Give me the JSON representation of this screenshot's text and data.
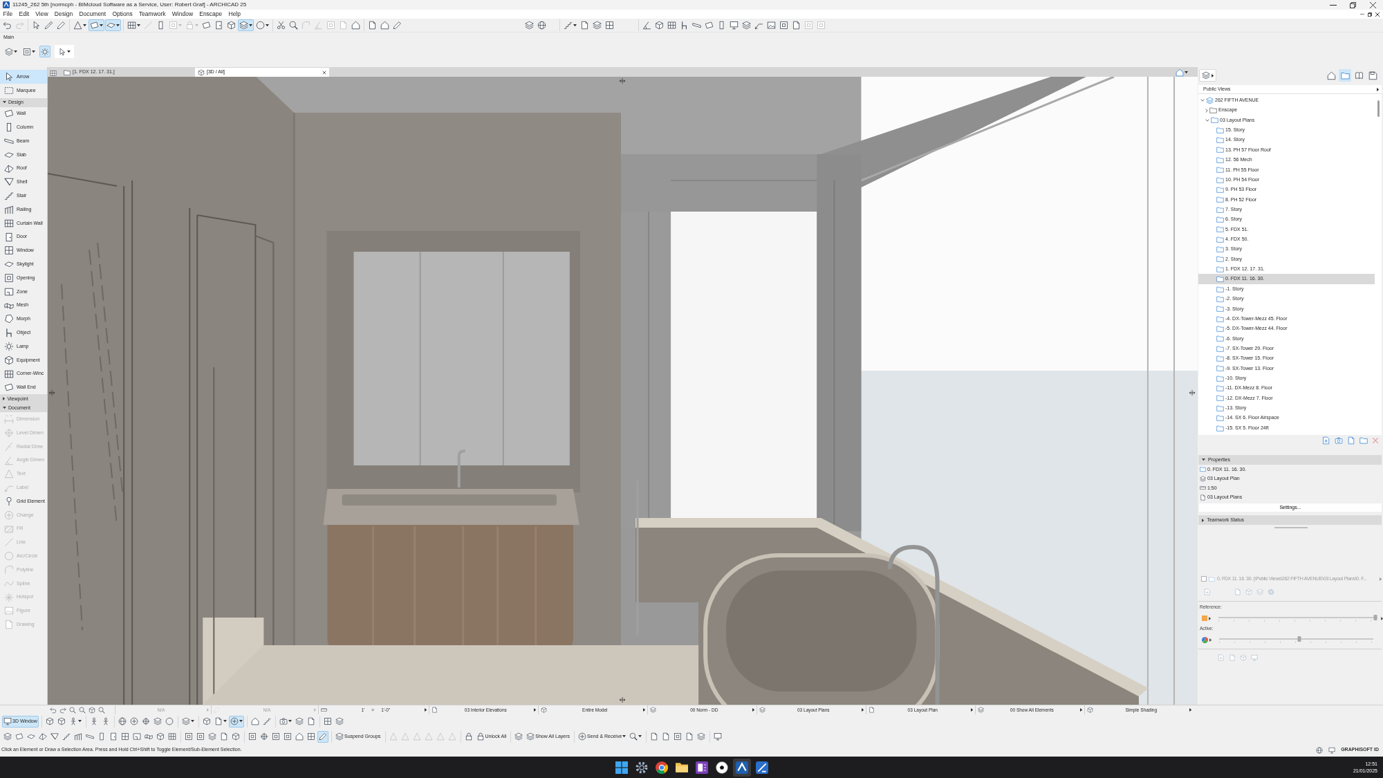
{
  "window": {
    "title": "11245_262 5th [normcph - BIMcloud Software as a Service, User: Robert Graf] - ARCHICAD 25"
  },
  "menu": [
    "File",
    "Edit",
    "View",
    "Design",
    "Document",
    "Options",
    "Teamwork",
    "Window",
    "Enscape",
    "Help"
  ],
  "toolbar": [
    [
      {
        "selected": false,
        "disabled": false,
        "dropdown": false
      },
      {
        "selected": false,
        "disabled": true,
        "dropdown": false
      }
    ],
    [
      {
        "selected": false,
        "disabled": false,
        "dropdown": false
      },
      {
        "selected": false,
        "disabled": false,
        "dropdown": false
      },
      {
        "selected": false,
        "disabled": false,
        "dropdown": false
      }
    ],
    [
      {
        "selected": false,
        "disabled": false,
        "dropdown": true
      },
      {
        "selected": true,
        "disabled": false,
        "dropdown": true
      },
      {
        "selected": true,
        "disabled": false,
        "dropdown": true
      }
    ],
    [
      {
        "selected": false,
        "disabled": false,
        "dropdown": true
      },
      {
        "selected": false,
        "disabled": true,
        "dropdown": false
      },
      {
        "selected": false,
        "disabled": false,
        "dropdown": false
      },
      {
        "selected": false,
        "disabled": true,
        "dropdown": true
      },
      {
        "selected": false,
        "disabled": true,
        "dropdown": true
      },
      {
        "selected": false,
        "disabled": false,
        "dropdown": false
      },
      {
        "selected": false,
        "disabled": false,
        "dropdown": false
      },
      {
        "selected": false,
        "disabled": false,
        "dropdown": false
      },
      {
        "selected": true,
        "disabled": false,
        "dropdown": true
      },
      {
        "selected": false,
        "disabled": false,
        "dropdown": true
      }
    ],
    [
      {
        "selected": false,
        "disabled": false,
        "dropdown": false
      },
      {
        "selected": false,
        "disabled": false,
        "dropdown": false
      },
      {
        "selected": false,
        "disabled": true,
        "dropdown": false
      },
      {
        "selected": false,
        "disabled": true,
        "dropdown": false
      },
      {
        "selected": false,
        "disabled": true,
        "dropdown": false
      },
      {
        "selected": false,
        "disabled": true,
        "dropdown": false
      },
      {
        "selected": false,
        "disabled": false,
        "dropdown": false
      }
    ],
    [
      {
        "selected": false,
        "disabled": false,
        "dropdown": false
      },
      {
        "selected": false,
        "disabled": false,
        "dropdown": false
      },
      {
        "selected": false,
        "disabled": false,
        "dropdown": false
      }
    ],
    [
      {
        "selected": false,
        "disabled": false,
        "dropdown": false
      },
      {
        "selected": false,
        "disabled": false,
        "dropdown": false
      }
    ],
    [
      {
        "selected": false,
        "disabled": false,
        "dropdown": true
      },
      {
        "selected": false,
        "disabled": false,
        "dropdown": false
      },
      {
        "selected": false,
        "disabled": false,
        "dropdown": false
      },
      {
        "selected": false,
        "disabled": false,
        "dropdown": false
      }
    ],
    [
      {
        "selected": false,
        "disabled": false,
        "dropdown": false
      },
      {
        "selected": false,
        "disabled": false,
        "dropdown": false
      },
      {
        "selected": false,
        "disabled": false,
        "dropdown": false
      },
      {
        "selected": false,
        "disabled": false,
        "dropdown": false
      },
      {
        "selected": false,
        "disabled": false,
        "dropdown": false
      },
      {
        "selected": false,
        "disabled": false,
        "dropdown": false
      },
      {
        "selected": false,
        "disabled": false,
        "dropdown": false
      },
      {
        "selected": false,
        "disabled": false,
        "dropdown": false
      },
      {
        "selected": false,
        "disabled": false,
        "dropdown": false
      },
      {
        "selected": false,
        "disabled": false,
        "dropdown": false
      },
      {
        "selected": false,
        "disabled": false,
        "dropdown": false
      },
      {
        "selected": false,
        "disabled": false,
        "dropdown": false
      },
      {
        "selected": false,
        "disabled": false,
        "dropdown": false
      },
      {
        "selected": false,
        "disabled": true,
        "dropdown": false
      },
      {
        "selected": false,
        "disabled": true,
        "dropdown": false
      }
    ]
  ],
  "main_toolbar": {
    "label": "Main",
    "groups": [
      [
        {
          "selected": false,
          "disabled": false,
          "dropdown": true
        },
        {
          "selected": false,
          "disabled": false,
          "dropdown": true
        },
        {
          "selected": true,
          "disabled": false,
          "dropdown": false
        }
      ],
      [
        {
          "selected": false,
          "disabled": false,
          "dropdown": true
        }
      ]
    ]
  },
  "tabs": [
    {
      "label": "[1. FDX 12. 17. 31.]",
      "selected": false
    },
    {
      "label": "[3D / All]",
      "selected": true
    }
  ],
  "toolbox": {
    "tools": [
      {
        "label": "Arrow",
        "selected": true,
        "disabled": false
      },
      {
        "label": "Marquee",
        "selected": false,
        "disabled": false
      }
    ],
    "sections": [
      {
        "label": "Design",
        "expanded": true,
        "tools": [
          {
            "label": "Wall",
            "selected": false,
            "disabled": false
          },
          {
            "label": "Column",
            "selected": false,
            "disabled": false
          },
          {
            "label": "Beam",
            "selected": false,
            "disabled": false
          },
          {
            "label": "Slab",
            "selected": false,
            "disabled": false
          },
          {
            "label": "Roof",
            "selected": false,
            "disabled": false
          },
          {
            "label": "Shell",
            "selected": false,
            "disabled": false
          },
          {
            "label": "Stair",
            "selected": false,
            "disabled": false
          },
          {
            "label": "Railing",
            "selected": false,
            "disabled": false
          },
          {
            "label": "Curtain Wall",
            "selected": false,
            "disabled": false
          },
          {
            "label": "Door",
            "selected": false,
            "disabled": false
          },
          {
            "label": "Window",
            "selected": false,
            "disabled": false
          },
          {
            "label": "Skylight",
            "selected": false,
            "disabled": false
          },
          {
            "label": "Opening",
            "selected": false,
            "disabled": false
          },
          {
            "label": "Zone",
            "selected": false,
            "disabled": false
          },
          {
            "label": "Mesh",
            "selected": false,
            "disabled": false
          },
          {
            "label": "Morph",
            "selected": false,
            "disabled": false
          },
          {
            "label": "Object",
            "selected": false,
            "disabled": false
          },
          {
            "label": "Lamp",
            "selected": false,
            "disabled": false
          },
          {
            "label": "Equipment",
            "selected": false,
            "disabled": false
          },
          {
            "label": "Corner-Winc",
            "selected": false,
            "disabled": false
          },
          {
            "label": "Wall End",
            "selected": false,
            "disabled": false
          }
        ]
      },
      {
        "label": "Viewpoint",
        "expanded": false
      },
      {
        "label": "Document",
        "expanded": true,
        "tools": [
          {
            "label": "Dimension",
            "selected": false,
            "disabled": true
          },
          {
            "label": "Level Dimen",
            "selected": false,
            "disabled": true
          },
          {
            "label": "Radial Dime",
            "selected": false,
            "disabled": true
          },
          {
            "label": "Angle Dimen",
            "selected": false,
            "disabled": true
          },
          {
            "label": "Text",
            "selected": false,
            "disabled": true
          },
          {
            "label": "Label",
            "selected": false,
            "disabled": true
          },
          {
            "label": "Grid Element",
            "selected": false,
            "disabled": false
          },
          {
            "label": "Change",
            "selected": false,
            "disabled": true
          },
          {
            "label": "Fill",
            "selected": false,
            "disabled": true
          },
          {
            "label": "Line",
            "selected": false,
            "disabled": true
          },
          {
            "label": "Arc/Circle",
            "selected": false,
            "disabled": true
          },
          {
            "label": "Polyline",
            "selected": false,
            "disabled": true
          },
          {
            "label": "Spline",
            "selected": false,
            "disabled": true
          },
          {
            "label": "Hotspot",
            "selected": false,
            "disabled": true
          },
          {
            "label": "Figure",
            "selected": false,
            "disabled": true
          },
          {
            "label": "Drawing",
            "selected": false,
            "disabled": true
          }
        ]
      }
    ]
  },
  "navigator": {
    "modes": [
      {
        "selected": false
      },
      {
        "selected": true
      },
      {
        "selected": false
      },
      {
        "selected": false
      }
    ],
    "view_selector": "Public Views",
    "tree": [
      {
        "label": "262 FIFTH AVENUE",
        "selected": false,
        "expanded": true,
        "children": [
          {
            "label": "Enscape",
            "selected": false,
            "expanded": false
          },
          {
            "label": "03 Layout Plans",
            "selected": false,
            "expanded": true,
            "children": [
              {
                "label": "15. Story",
                "selected": false
              },
              {
                "label": "14. Story",
                "selected": false
              },
              {
                "label": "13. PH 57 Floor Roof",
                "selected": false
              },
              {
                "label": "12. 56 Mech",
                "selected": false
              },
              {
                "label": "11. PH 55 Floor",
                "selected": false
              },
              {
                "label": "10. PH 54 Floor",
                "selected": false
              },
              {
                "label": "9. PH 53 Floor",
                "selected": false
              },
              {
                "label": "8. PH 52 Floor",
                "selected": false
              },
              {
                "label": "7. Story",
                "selected": false
              },
              {
                "label": "6. Story",
                "selected": false
              },
              {
                "label": "5. FDX 51.",
                "selected": false
              },
              {
                "label": "4. FDX 50.",
                "selected": false
              },
              {
                "label": "3. Story",
                "selected": false
              },
              {
                "label": "2. Story",
                "selected": false
              },
              {
                "label": "1. FDX 12. 17. 31.",
                "selected": false
              },
              {
                "label": "0. FDX 11. 16. 30.",
                "selected": true
              },
              {
                "label": "-1. Story",
                "selected": false
              },
              {
                "label": "-2. Story",
                "selected": false
              },
              {
                "label": "-3. Story",
                "selected": false
              },
              {
                "label": "-4. DX-Tower-Mezz 45. Floor",
                "selected": false
              },
              {
                "label": "-5. DX-Tower-Mezz 44. Floor",
                "selected": false
              },
              {
                "label": "-6. Story",
                "selected": false
              },
              {
                "label": "-7. SX-Tower 29. Floor",
                "selected": false
              },
              {
                "label": "-8. SX-Tower 15. Floor",
                "selected": false
              },
              {
                "label": "-9. SX-Tower 13. Floor",
                "selected": false
              },
              {
                "label": "-10. Story",
                "selected": false
              },
              {
                "label": "-11. DX-Mezz 8. Floor",
                "selected": false
              },
              {
                "label": "-12. DX-Mezz 7. Floor",
                "selected": false
              },
              {
                "label": "-13. Story",
                "selected": false
              },
              {
                "label": "-14. SX 6. Floor Airspace",
                "selected": false
              },
              {
                "label": "-15. SX 5. Floor 24ft",
                "selected": false
              }
            ]
          }
        ]
      }
    ]
  },
  "properties": {
    "title": "Properties",
    "expanded": true,
    "rows": [
      "0. FDX 11. 16. 30.",
      "03 Layout Plan",
      "1:50",
      "03 Layout Plans"
    ],
    "button": "Settings..."
  },
  "teamwork_status": {
    "title": "Teamwork Status",
    "expanded": false
  },
  "teamwork_item": {
    "checked": false,
    "disabled": true,
    "text": "0. FDX 11. 16. 30. (\\Public Views\\262 FIFTH AVENUE\\03 Layout Plans\\0. F..."
  },
  "transparency": [
    {
      "label": "Reference:",
      "kind": "swatch",
      "level": 0.99
    },
    {
      "label": "Active:",
      "kind": "wheel",
      "level": 0.52
    }
  ],
  "quick_options": {
    "zoom_fields": [
      {
        "value": "N/A",
        "disabled": true
      },
      {
        "value": "N/A",
        "disabled": true
      }
    ],
    "scale": [
      "1'",
      "=",
      "1'-0\""
    ],
    "fields": [
      "03 Interior Elevations",
      "Entire Model",
      "00 Norm - DD",
      "03 Layout Plans",
      "03 Layout Plan",
      "00 Show All Elements",
      "Simple Shading"
    ]
  },
  "bottom_toolbars": [
    [
      [
        {
          "label": "3D Window",
          "selected": true,
          "disabled": false,
          "dropdown": false
        }
      ],
      [
        {
          "selected": false,
          "disabled": false,
          "dropdown": false
        },
        {
          "selected": false,
          "disabled": false,
          "dropdown": false
        },
        {
          "selected": false,
          "disabled": false,
          "dropdown": true
        }
      ],
      [
        {
          "selected": false,
          "disabled": false,
          "dropdown": false
        },
        {
          "selected": false,
          "disabled": false,
          "dropdown": false
        }
      ],
      [
        {
          "selected": false,
          "disabled": false,
          "dropdown": false
        },
        {
          "selected": false,
          "disabled": false,
          "dropdown": false
        },
        {
          "selected": false,
          "disabled": false,
          "dropdown": false
        },
        {
          "selected": false,
          "disabled": false,
          "dropdown": false
        },
        {
          "selected": false,
          "disabled": false,
          "dropdown": false
        }
      ],
      [
        {
          "selected": false,
          "disabled": false,
          "dropdown": true
        }
      ],
      [
        {
          "selected": false,
          "disabled": false,
          "dropdown": false
        },
        {
          "selected": false,
          "disabled": false,
          "dropdown": true
        },
        {
          "selected": true,
          "disabled": false,
          "dropdown": true
        }
      ],
      [
        {
          "selected": false,
          "disabled": false,
          "dropdown": false
        },
        {
          "selected": false,
          "disabled": false,
          "dropdown": false
        }
      ],
      [
        {
          "selected": false,
          "disabled": false,
          "dropdown": true
        },
        {
          "selected": false,
          "disabled": false,
          "dropdown": false
        },
        {
          "selected": false,
          "disabled": false,
          "dropdown": false
        }
      ],
      [
        {
          "selected": false,
          "disabled": false,
          "dropdown": false
        },
        {
          "selected": false,
          "disabled": false,
          "dropdown": false
        }
      ]
    ],
    [
      [
        {
          "selected": false,
          "disabled": false,
          "dropdown": false
        },
        {
          "selected": false,
          "disabled": false,
          "dropdown": false
        },
        {
          "selected": false,
          "disabled": false,
          "dropdown": false
        },
        {
          "selected": false,
          "disabled": false,
          "dropdown": false
        },
        {
          "selected": false,
          "disabled": false,
          "dropdown": false
        },
        {
          "selected": false,
          "disabled": false,
          "dropdown": false
        },
        {
          "selected": false,
          "disabled": false,
          "dropdown": false
        },
        {
          "selected": false,
          "disabled": false,
          "dropdown": false
        },
        {
          "selected": false,
          "disabled": false,
          "dropdown": false
        },
        {
          "selected": false,
          "disabled": false,
          "dropdown": false
        },
        {
          "selected": false,
          "disabled": false,
          "dropdown": false
        },
        {
          "selected": false,
          "disabled": false,
          "dropdown": false
        },
        {
          "selected": false,
          "disabled": false,
          "dropdown": false
        },
        {
          "selected": false,
          "disabled": false,
          "dropdown": false
        },
        {
          "selected": false,
          "disabled": false,
          "dropdown": false
        }
      ],
      [
        {
          "selected": false,
          "disabled": false,
          "dropdown": false
        },
        {
          "selected": false,
          "disabled": false,
          "dropdown": false
        },
        {
          "selected": false,
          "disabled": false,
          "dropdown": false
        },
        {
          "selected": false,
          "disabled": false,
          "dropdown": false
        },
        {
          "selected": false,
          "disabled": false,
          "dropdown": false
        }
      ],
      [
        {
          "selected": false,
          "disabled": false,
          "dropdown": false
        },
        {
          "selected": false,
          "disabled": false,
          "dropdown": false
        },
        {
          "selected": false,
          "disabled": false,
          "dropdown": false
        },
        {
          "selected": false,
          "disabled": false,
          "dropdown": false
        },
        {
          "selected": false,
          "disabled": false,
          "dropdown": false
        },
        {
          "selected": false,
          "disabled": false,
          "dropdown": false
        },
        {
          "selected": true,
          "disabled": false,
          "dropdown": false
        }
      ],
      [
        {
          "label": "Suspend Groups",
          "selected": false,
          "disabled": false,
          "dropdown": false
        }
      ],
      [
        {
          "selected": false,
          "disabled": true,
          "dropdown": false
        },
        {
          "selected": false,
          "disabled": true,
          "dropdown": false
        },
        {
          "selected": false,
          "disabled": true,
          "dropdown": false
        },
        {
          "selected": false,
          "disabled": true,
          "dropdown": false
        },
        {
          "selected": false,
          "disabled": true,
          "dropdown": false
        },
        {
          "selected": false,
          "disabled": true,
          "dropdown": false
        }
      ],
      [
        {
          "selected": false,
          "disabled": false,
          "dropdown": false
        },
        {
          "label": "Unlock All",
          "selected": false,
          "disabled": false,
          "dropdown": false
        }
      ],
      [
        {
          "selected": false,
          "disabled": false,
          "dropdown": false
        },
        {
          "label": "Show All Layers",
          "selected": false,
          "disabled": false,
          "dropdown": false
        }
      ],
      [
        {
          "label": "Send & Receive",
          "selected": false,
          "disabled": false,
          "dropdown": true
        },
        {
          "selected": false,
          "disabled": false,
          "dropdown": true
        }
      ],
      [
        {
          "selected": false,
          "disabled": false,
          "dropdown": false
        },
        {
          "selected": false,
          "disabled": false,
          "dropdown": false
        },
        {
          "selected": false,
          "disabled": false,
          "dropdown": false
        },
        {
          "selected": false,
          "disabled": false,
          "dropdown": false
        },
        {
          "selected": false,
          "disabled": false,
          "dropdown": false
        }
      ],
      [
        {
          "selected": false,
          "disabled": false,
          "dropdown": false
        }
      ]
    ]
  ],
  "status_bar": {
    "message": "Click an Element or Draw a Selection Area. Press and Hold Ctrl+Shift to Toggle Element/Sub-Element Selection.",
    "account": "GRAPHISOFT ID"
  },
  "taskbar": {
    "apps": [
      {
        "selected": false
      },
      {
        "selected": false
      },
      {
        "selected": false
      },
      {
        "selected": false
      },
      {
        "selected": false
      },
      {
        "selected": false
      },
      {
        "selected": true
      },
      {
        "selected": false
      }
    ],
    "time": "12:51",
    "date": "21/01/2025"
  }
}
